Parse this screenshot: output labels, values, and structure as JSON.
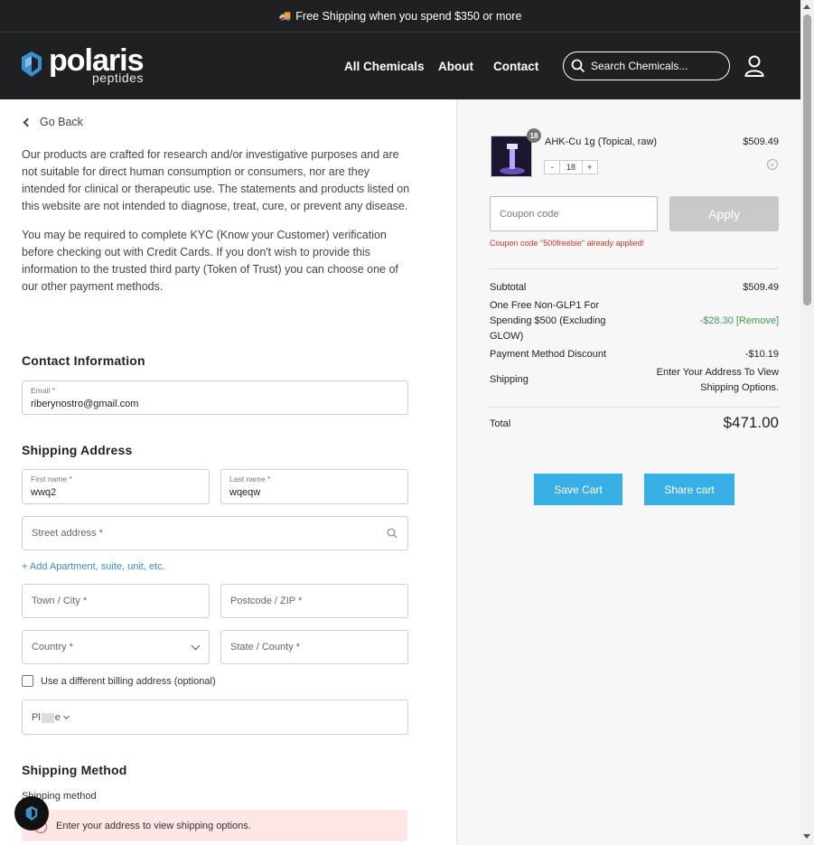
{
  "announcement": {
    "text": "Free Shipping when you spend $350 or more",
    "icon": "truck-icon"
  },
  "logo": {
    "word": "polaris",
    "sub": "peptides"
  },
  "nav": {
    "items": [
      "All Chemicals",
      "About",
      "Contact"
    ]
  },
  "search": {
    "placeholder": "Search Chemicals..."
  },
  "go_back": "Go Back",
  "disclaimer": {
    "p1": "Our products are crafted for research and/or investigative purposes and are not suitable for direct human consumption or consumers, nor are they intended for clinical or therapeutic use. The statements and products listed on this website are not intended to diagnose, treat, cure, or prevent any disease.",
    "p2": "You may be required to complete KYC (Know your Customer) verification before checking out with Credit Cards.  If you don't wish to provide this information to the trusted third party (Token of Trust) you can choose one of our other payment methods."
  },
  "contact": {
    "title": "Contact Information",
    "email_label": "Email *",
    "email_value": "riberynostro@gmail.com"
  },
  "shipping": {
    "title": "Shipping Address",
    "first_name_label": "First name *",
    "first_name_value": "wwq2",
    "last_name_label": "Last name *",
    "last_name_value": "wqeqw",
    "street_placeholder": "Street address *",
    "add_apartment": "+ Add Apartment, suite, unit, etc.",
    "city_placeholder": "Town / City *",
    "postcode_placeholder": "Postcode / ZIP *",
    "country_placeholder": "Country *",
    "state_placeholder": "State / County *",
    "billing_checkbox": "Use a different billing address (optional)",
    "phone_prefix": "Pl",
    "phone_suffix": "e"
  },
  "shipping_method": {
    "title": "Shipping Method",
    "label": "Shipping method",
    "alert": "Enter your address to view shipping options."
  },
  "cart": {
    "item": {
      "name": "AHK-Cu 1g (Topical, raw)",
      "price": "$509.49",
      "quantity": "18",
      "badge": "18",
      "minus": "-",
      "plus": "+",
      "remove": "×"
    },
    "coupon_placeholder": "Coupon code",
    "apply_label": "Apply",
    "coupon_message": "Coupon code \"500freebie\" already applied!",
    "subtotal_label": "Subtotal",
    "subtotal_value": "$509.49",
    "discount_label": "One Free Non-GLP1 For Spending $500 (Excluding GLOW)",
    "discount_value": "-$28.30",
    "discount_remove": "[Remove]",
    "payment_discount_label": "Payment Method Discount",
    "payment_discount_value": "-$10.19",
    "shipping_label": "Shipping",
    "shipping_value": "Enter Your Address To View Shipping Options.",
    "total_label": "Total",
    "total_value": "$471.00",
    "save_cart": "Save Cart",
    "share_cart": "Share cart"
  },
  "colors": {
    "header_bg": "#1f2022",
    "accent_blue": "#38b0e5",
    "logo_blue": "#3a8fcf",
    "error_red": "#d63a1f",
    "discount_green": "#3e9a53",
    "alert_bg": "#fde6e6"
  }
}
